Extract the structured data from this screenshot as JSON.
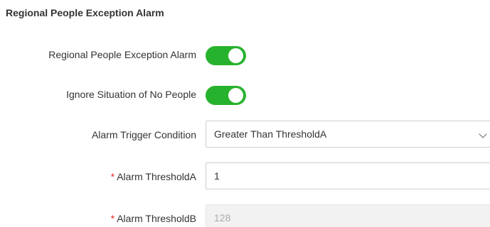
{
  "section": {
    "title": "Regional People Exception Alarm"
  },
  "rows": {
    "alarm_enable": {
      "label": "Regional People Exception Alarm",
      "enabled": true
    },
    "ignore_no_people": {
      "label": "Ignore Situation of No People",
      "enabled": true
    },
    "trigger_condition": {
      "label": "Alarm Trigger Condition",
      "value": "Greater Than ThresholdA",
      "icon": "chevron-down-icon"
    },
    "threshold_a": {
      "required_mark": "*",
      "label": "Alarm ThresholdA",
      "value": "1"
    },
    "threshold_b": {
      "required_mark": "*",
      "label": "Alarm ThresholdB",
      "value": "128",
      "disabled": true
    }
  },
  "colors": {
    "toggle_on": "#27b22e",
    "required": "#e72b2b",
    "disabled_bg": "#f2f2f2"
  }
}
